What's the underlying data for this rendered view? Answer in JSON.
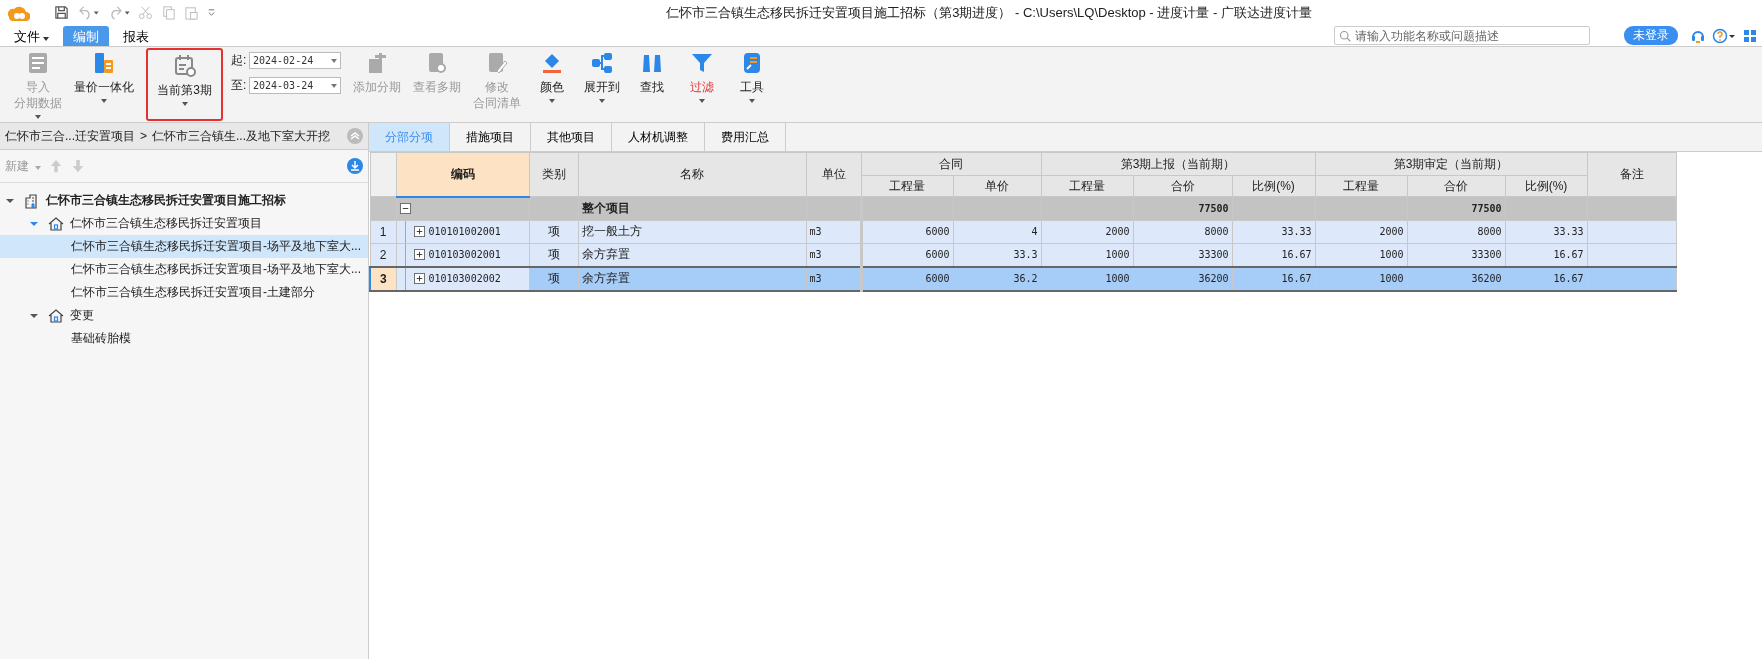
{
  "window": {
    "title": "仁怀市三合镇生态移民拆迁安置项目施工招标（第3期进度） - C:\\Users\\LQ\\Desktop - 进度计量 - 广联达进度计量"
  },
  "menu": [
    {
      "label": "文件",
      "dropdown": true,
      "selected": false
    },
    {
      "label": "编制",
      "dropdown": false,
      "selected": true
    },
    {
      "label": "报表",
      "dropdown": false,
      "selected": false
    }
  ],
  "search": {
    "placeholder": "请输入功能名称或问题描述"
  },
  "login_button": "未登录",
  "ribbon": [
    {
      "kind": "button",
      "label": "导入",
      "label2": "分期数据",
      "disabled": true,
      "dropdown": true,
      "highlighted": false,
      "active": false
    },
    {
      "kind": "button",
      "label": "量价一体化",
      "disabled": false,
      "dropdown": true,
      "highlighted": false,
      "active": false
    },
    {
      "kind": "button",
      "label": "当前第3期",
      "disabled": false,
      "dropdown": true,
      "highlighted": true,
      "active": false
    },
    {
      "kind": "dates",
      "fields": [
        {
          "label": "起:",
          "value": "2024-02-24"
        },
        {
          "label": "至:",
          "value": "2024-03-24"
        }
      ]
    },
    {
      "kind": "button",
      "label": "添加分期",
      "disabled": true,
      "dropdown": false,
      "highlighted": false,
      "active": false
    },
    {
      "kind": "button",
      "label": "查看多期",
      "disabled": true,
      "dropdown": false,
      "highlighted": false,
      "active": false
    },
    {
      "kind": "button",
      "label": "修改",
      "label2": "合同清单",
      "disabled": true,
      "dropdown": false,
      "highlighted": false,
      "active": false
    },
    {
      "kind": "button",
      "label": "颜色",
      "disabled": false,
      "dropdown": true,
      "highlighted": false,
      "active": false
    },
    {
      "kind": "button",
      "label": "展开到",
      "disabled": false,
      "dropdown": true,
      "highlighted": false,
      "active": false
    },
    {
      "kind": "button",
      "label": "查找",
      "disabled": false,
      "dropdown": false,
      "highlighted": false,
      "active": false
    },
    {
      "kind": "button",
      "label": "过滤",
      "disabled": false,
      "dropdown": true,
      "highlighted": false,
      "active": true
    },
    {
      "kind": "button",
      "label": "工具",
      "disabled": false,
      "dropdown": true,
      "highlighted": false,
      "active": false
    }
  ],
  "sidebar": {
    "breadcrumb": [
      "仁怀市三合...迁安置项目",
      "仁怀市三合镇生...及地下室大开挖"
    ],
    "breadcrumb_separator": ">",
    "new_button": {
      "label": "新建",
      "disabled": true
    },
    "tree": [
      {
        "label": "仁怀市三合镇生态移民拆迁安置项目施工招标",
        "expanded": true,
        "selected": false,
        "children": [
          {
            "label": "仁怀市三合镇生态移民拆迁安置项目",
            "expanded": true,
            "selected": false,
            "children": [
              {
                "label": "仁怀市三合镇生态移民拆迁安置项目-场平及地下室大...",
                "selected": true
              },
              {
                "label": "仁怀市三合镇生态移民拆迁安置项目-场平及地下室大...",
                "selected": false
              },
              {
                "label": "仁怀市三合镇生态移民拆迁安置项目-土建部分",
                "selected": false
              }
            ]
          },
          {
            "label": "变更",
            "expanded": true,
            "selected": false,
            "children": [
              {
                "label": "基础砖胎模",
                "selected": false
              }
            ]
          }
        ]
      }
    ]
  },
  "tabs": [
    {
      "label": "分部分项",
      "selected": true
    },
    {
      "label": "措施项目",
      "selected": false
    },
    {
      "label": "其他项目",
      "selected": false
    },
    {
      "label": "人材机调整",
      "selected": false
    },
    {
      "label": "费用汇总",
      "selected": false
    }
  ],
  "table": {
    "column_groups": [
      {
        "label": "合同"
      },
      {
        "label": "第3期上报（当前期）"
      },
      {
        "label": "第3期审定（当前期）"
      }
    ],
    "columns": [
      {
        "label": "编码",
        "selected": true
      },
      {
        "label": "类别",
        "selected": false
      },
      {
        "label": "名称",
        "selected": false
      },
      {
        "label": "单位",
        "selected": false
      },
      {
        "label": "工程量",
        "selected": false
      },
      {
        "label": "单价",
        "selected": false
      },
      {
        "label": "工程量",
        "selected": false
      },
      {
        "label": "合价",
        "selected": false
      },
      {
        "label": "比例(%)",
        "selected": false
      },
      {
        "label": "工程量",
        "selected": false
      },
      {
        "label": "合价",
        "selected": false
      },
      {
        "label": "比例(%)",
        "selected": false
      },
      {
        "label": "备注",
        "selected": false
      }
    ],
    "rows": [
      {
        "kind": "group",
        "expanded": true,
        "selected": false,
        "cells": [
          "",
          "",
          "整个项目",
          "",
          "",
          "",
          "",
          "77500",
          "",
          "",
          "77500",
          "",
          ""
        ]
      },
      {
        "kind": "item",
        "expanded": false,
        "selected": false,
        "number": "1",
        "cells": [
          "010101002001",
          "项",
          "挖一般土方",
          "m3",
          "6000",
          "4",
          "2000",
          "8000",
          "33.33",
          "2000",
          "8000",
          "33.33",
          ""
        ]
      },
      {
        "kind": "item",
        "expanded": false,
        "selected": false,
        "number": "2",
        "cells": [
          "010103002001",
          "项",
          "余方弃置",
          "m3",
          "6000",
          "33.3",
          "1000",
          "33300",
          "16.67",
          "1000",
          "33300",
          "16.67",
          ""
        ]
      },
      {
        "kind": "item",
        "expanded": false,
        "selected": true,
        "number": "3",
        "cells": [
          "010103002002",
          "项",
          "余方弃置",
          "m3",
          "6000",
          "36.2",
          "1000",
          "36200",
          "16.67",
          "1000",
          "36200",
          "16.67",
          ""
        ]
      }
    ]
  }
}
